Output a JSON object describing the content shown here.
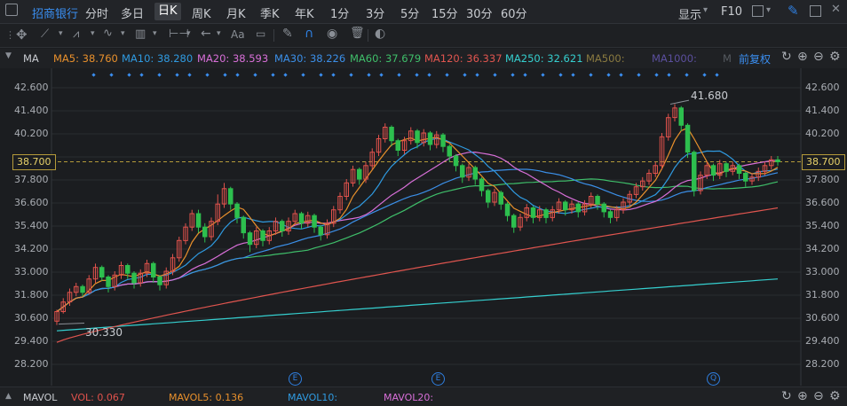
{
  "header": {
    "stock_name": "招商银行",
    "periods": [
      "分时",
      "多日",
      "日K",
      "周K",
      "月K",
      "季K",
      "年K",
      "1分",
      "3分",
      "5分",
      "15分",
      "30分",
      "60分"
    ],
    "active_period": "日K",
    "display_label": "显示",
    "f10_label": "F10"
  },
  "toolbar": {
    "font_label": "Aa"
  },
  "indicator_bar": {
    "name": "MA",
    "adjust_label": "前复权",
    "items": [
      {
        "label": "MA5: 38.760",
        "color": "#e8902c"
      },
      {
        "label": "MA10: 38.280",
        "color": "#2f9ae0"
      },
      {
        "label": "MA20: 38.593",
        "color": "#d86fd8"
      },
      {
        "label": "MA30: 38.226",
        "color": "#3b8fe8"
      },
      {
        "label": "MA60: 37.679",
        "color": "#3fbf6a"
      },
      {
        "label": "MA120: 36.337",
        "color": "#e0554f"
      },
      {
        "label": "MA250: 32.621",
        "color": "#35cfcf"
      },
      {
        "label": "MA500:",
        "color": "#8a7a40"
      },
      {
        "label": "MA1000:",
        "color": "#5b4f9e"
      },
      {
        "label": "M",
        "color": "#555a60"
      }
    ]
  },
  "price_axis": {
    "ticks": [
      "42.600",
      "41.400",
      "40.200",
      "38.700",
      "37.800",
      "36.600",
      "35.400",
      "34.200",
      "33.000",
      "31.800",
      "30.600",
      "29.400",
      "28.200"
    ],
    "current_price": "38.700"
  },
  "annotations": {
    "high_label": "41.680",
    "low_label": "30.330",
    "event_markers": [
      "E",
      "E",
      "Q"
    ]
  },
  "volume_bar": {
    "name": "MAVOL",
    "vol": "VOL: 0.067",
    "mavol5": "MAVOL5: 0.136",
    "mavol10": "MAVOL10:",
    "mavol20": "MAVOL20:"
  },
  "colors": {
    "up": "#e0524c",
    "down": "#2dbf4e",
    "ma5": "#e8902c",
    "ma10": "#2f9ae0",
    "ma20": "#d86fd8",
    "ma30": "#3b8fe8",
    "ma60": "#3fbf6a",
    "ma120": "#e0554f",
    "ma250": "#35cfcf"
  },
  "chart_data": {
    "type": "candlestick",
    "ylim": [
      28.2,
      42.6
    ],
    "candles": [
      [
        30.4,
        30.9,
        30.2,
        31.0
      ],
      [
        30.9,
        31.4,
        30.8,
        31.6
      ],
      [
        31.4,
        31.9,
        31.2,
        32.1
      ],
      [
        31.9,
        32.2,
        31.7,
        32.4
      ],
      [
        32.2,
        31.9,
        31.7,
        32.3
      ],
      [
        31.9,
        32.6,
        31.8,
        32.8
      ],
      [
        32.6,
        33.2,
        32.4,
        33.4
      ],
      [
        33.2,
        32.7,
        32.5,
        33.3
      ],
      [
        32.7,
        32.2,
        31.9,
        32.8
      ],
      [
        32.2,
        32.8,
        32.0,
        33.0
      ],
      [
        32.8,
        33.3,
        32.6,
        33.5
      ],
      [
        33.3,
        32.9,
        32.6,
        33.4
      ],
      [
        32.9,
        32.4,
        32.1,
        33.0
      ],
      [
        32.4,
        32.9,
        32.2,
        33.1
      ],
      [
        32.9,
        33.4,
        32.7,
        33.6
      ],
      [
        33.4,
        32.7,
        32.4,
        33.5
      ],
      [
        32.7,
        32.3,
        32.0,
        32.8
      ],
      [
        32.3,
        33.0,
        32.1,
        33.2
      ],
      [
        33.0,
        33.7,
        32.8,
        33.9
      ],
      [
        33.7,
        34.6,
        33.5,
        34.8
      ],
      [
        34.6,
        35.3,
        34.4,
        35.5
      ],
      [
        35.3,
        36.0,
        35.1,
        36.2
      ],
      [
        36.0,
        35.3,
        35.0,
        36.2
      ],
      [
        35.3,
        34.8,
        34.5,
        35.5
      ],
      [
        34.8,
        35.6,
        34.6,
        35.8
      ],
      [
        35.6,
        36.5,
        35.4,
        37.0
      ],
      [
        36.5,
        37.3,
        36.3,
        37.6
      ],
      [
        37.3,
        36.5,
        36.2,
        37.4
      ],
      [
        36.5,
        35.8,
        35.5,
        36.6
      ],
      [
        35.8,
        35.0,
        34.7,
        35.9
      ],
      [
        35.0,
        34.4,
        34.0,
        35.1
      ],
      [
        34.4,
        35.1,
        34.2,
        35.3
      ],
      [
        35.1,
        34.6,
        34.3,
        35.2
      ],
      [
        34.6,
        35.1,
        34.4,
        35.3
      ],
      [
        35.1,
        35.6,
        34.9,
        35.8
      ],
      [
        35.6,
        35.1,
        34.8,
        35.7
      ],
      [
        35.1,
        35.6,
        34.9,
        35.8
      ],
      [
        35.6,
        36.0,
        35.4,
        36.2
      ],
      [
        36.0,
        35.5,
        35.2,
        36.1
      ],
      [
        35.5,
        35.9,
        35.3,
        36.1
      ],
      [
        35.9,
        35.3,
        35.0,
        36.0
      ],
      [
        35.3,
        34.9,
        34.6,
        35.4
      ],
      [
        34.9,
        35.5,
        34.7,
        35.7
      ],
      [
        35.5,
        36.2,
        35.3,
        36.4
      ],
      [
        36.2,
        36.9,
        36.0,
        37.1
      ],
      [
        36.9,
        37.6,
        36.7,
        37.8
      ],
      [
        37.6,
        38.3,
        37.4,
        38.5
      ],
      [
        38.3,
        37.8,
        37.5,
        38.4
      ],
      [
        37.8,
        38.5,
        37.6,
        38.7
      ],
      [
        38.5,
        39.2,
        38.3,
        39.4
      ],
      [
        39.2,
        39.9,
        39.0,
        40.1
      ],
      [
        39.9,
        40.5,
        39.7,
        40.7
      ],
      [
        40.5,
        39.8,
        39.5,
        40.6
      ],
      [
        39.8,
        39.3,
        39.0,
        39.9
      ],
      [
        39.3,
        39.8,
        39.1,
        40.0
      ],
      [
        39.8,
        40.3,
        39.6,
        40.5
      ],
      [
        40.3,
        39.7,
        39.4,
        40.4
      ],
      [
        39.7,
        40.2,
        39.5,
        40.4
      ],
      [
        40.2,
        39.6,
        39.3,
        40.3
      ],
      [
        39.6,
        40.1,
        39.4,
        40.3
      ],
      [
        40.1,
        39.5,
        39.2,
        40.2
      ],
      [
        39.5,
        39.0,
        38.7,
        39.6
      ],
      [
        39.0,
        38.5,
        38.2,
        39.1
      ],
      [
        38.5,
        37.9,
        37.6,
        38.6
      ],
      [
        37.9,
        38.4,
        37.7,
        38.6
      ],
      [
        38.4,
        37.8,
        37.5,
        38.5
      ],
      [
        37.8,
        37.2,
        36.9,
        37.9
      ],
      [
        37.2,
        36.6,
        36.3,
        37.3
      ],
      [
        36.6,
        37.1,
        36.4,
        37.3
      ],
      [
        37.1,
        36.5,
        36.2,
        37.2
      ],
      [
        36.5,
        35.9,
        35.6,
        36.6
      ],
      [
        35.9,
        35.3,
        35.0,
        36.0
      ],
      [
        35.3,
        35.8,
        35.1,
        36.0
      ],
      [
        35.8,
        36.3,
        35.6,
        36.5
      ],
      [
        36.3,
        35.8,
        35.5,
        36.4
      ],
      [
        35.8,
        36.2,
        35.6,
        36.4
      ],
      [
        36.2,
        35.8,
        35.5,
        36.3
      ],
      [
        35.8,
        36.2,
        35.6,
        36.4
      ],
      [
        36.2,
        36.6,
        36.0,
        36.8
      ],
      [
        36.6,
        36.2,
        35.9,
        36.7
      ],
      [
        36.2,
        36.5,
        36.0,
        36.7
      ],
      [
        36.5,
        36.1,
        35.8,
        36.6
      ],
      [
        36.1,
        36.5,
        35.9,
        36.7
      ],
      [
        36.5,
        36.9,
        36.3,
        37.1
      ],
      [
        36.9,
        36.5,
        36.2,
        37.0
      ],
      [
        36.5,
        36.1,
        35.8,
        36.6
      ],
      [
        36.1,
        35.8,
        35.5,
        36.2
      ],
      [
        35.8,
        36.2,
        35.6,
        36.4
      ],
      [
        36.2,
        36.6,
        36.0,
        36.8
      ],
      [
        36.6,
        37.0,
        36.4,
        37.2
      ],
      [
        37.0,
        37.4,
        36.8,
        37.6
      ],
      [
        37.4,
        37.7,
        37.2,
        37.9
      ],
      [
        37.7,
        38.1,
        37.5,
        38.3
      ],
      [
        38.1,
        38.5,
        37.9,
        38.7
      ],
      [
        38.5,
        40.0,
        38.3,
        40.2
      ],
      [
        40.0,
        41.0,
        39.8,
        41.2
      ],
      [
        41.0,
        41.5,
        40.8,
        41.7
      ],
      [
        41.5,
        40.6,
        40.3,
        41.6
      ],
      [
        40.6,
        39.2,
        38.9,
        40.7
      ],
      [
        39.2,
        37.2,
        36.9,
        39.3
      ],
      [
        37.2,
        38.0,
        37.0,
        38.2
      ],
      [
        38.0,
        38.5,
        37.8,
        38.7
      ],
      [
        38.5,
        38.0,
        37.7,
        38.6
      ],
      [
        38.0,
        38.6,
        37.8,
        38.8
      ],
      [
        38.6,
        38.2,
        37.9,
        38.7
      ],
      [
        38.2,
        38.5,
        38.0,
        38.7
      ],
      [
        38.5,
        38.1,
        37.8,
        38.6
      ],
      [
        38.1,
        37.7,
        37.4,
        38.2
      ],
      [
        37.7,
        37.9,
        37.5,
        38.1
      ],
      [
        37.9,
        38.2,
        37.7,
        38.4
      ],
      [
        38.2,
        38.5,
        38.0,
        38.7
      ],
      [
        38.5,
        38.8,
        38.3,
        39.0
      ],
      [
        38.8,
        38.7,
        38.5,
        39.0
      ]
    ]
  }
}
